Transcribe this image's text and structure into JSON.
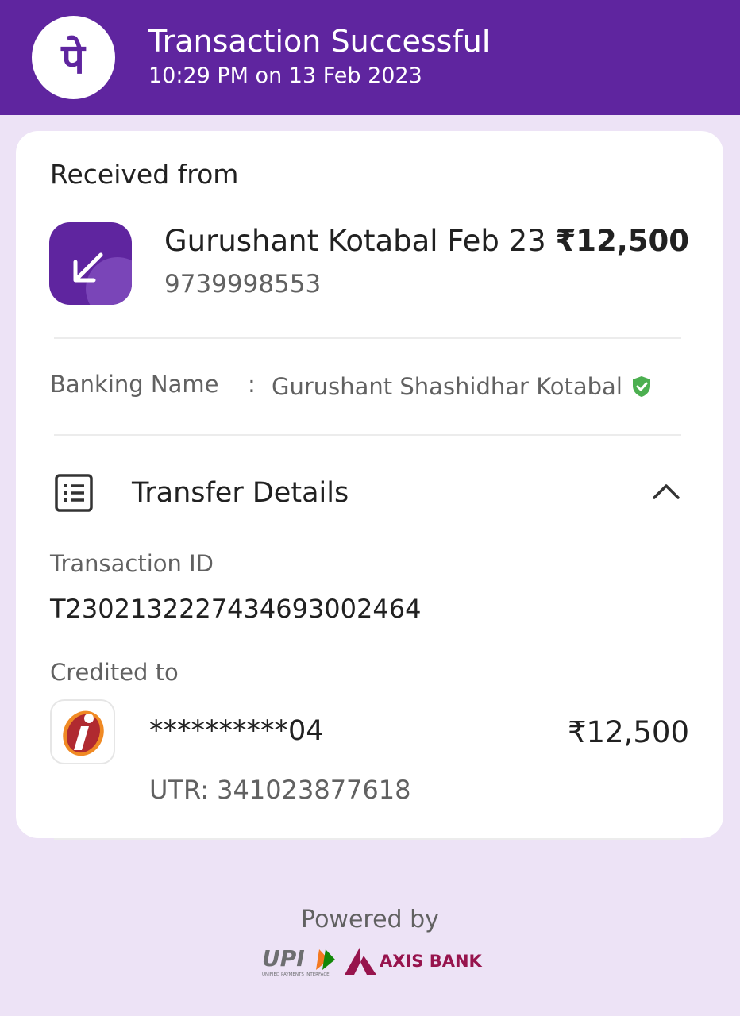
{
  "header": {
    "title": "Transaction Successful",
    "datetime": "10:29 PM on 13 Feb 2023",
    "logo_glyph": "पे",
    "color": "#5f259f"
  },
  "received": {
    "heading": "Received from",
    "payer_name": "Gurushant Kotabal Feb 23",
    "amount": "₹12,500",
    "phone": "9739998553",
    "icon": "arrow-down-left-icon"
  },
  "banking": {
    "label": "Banking Name",
    "colon": ":",
    "value": "Gurushant  Shashidhar Kotabal",
    "verified_icon": "verified-shield-icon",
    "verified_color": "#4caf50"
  },
  "transfer": {
    "title": "Transfer Details",
    "icon": "document-list-icon",
    "toggle_icon": "chevron-up-icon",
    "txn_id_label": "Transaction ID",
    "txn_id": "T2302132227434693002464",
    "credited_label": "Credited to",
    "account_masked": "**********04",
    "credited_amount": "₹12,500",
    "utr": "UTR: 341023877618",
    "bank_icon": "icici-bank-logo"
  },
  "footer": {
    "powered_by": "Powered by",
    "upi_logo_text": "UPI",
    "upi_tagline": "UNIFIED PAYMENTS INTERFACE",
    "bank_name": "AXIS BANK"
  }
}
